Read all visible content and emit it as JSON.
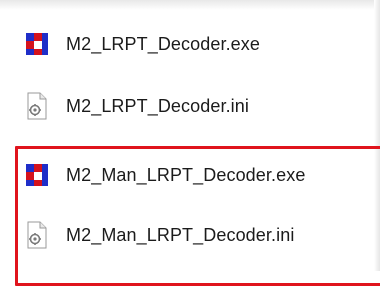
{
  "files": [
    {
      "name": "M2_LRPT_Decoder.exe",
      "icon": "exe-app-icon"
    },
    {
      "name": "M2_LRPT_Decoder.ini",
      "icon": "ini-settings-icon"
    },
    {
      "name": "M2_Man_LRPT_Decoder.exe",
      "icon": "exe-app-icon"
    },
    {
      "name": "M2_Man_LRPT_Decoder.ini",
      "icon": "ini-settings-icon"
    }
  ],
  "colors": {
    "highlight_border": "#e0141d",
    "exe_icon_blue": "#1f2ec8",
    "exe_icon_red": "#d4121c",
    "text": "#1b1b1b"
  }
}
